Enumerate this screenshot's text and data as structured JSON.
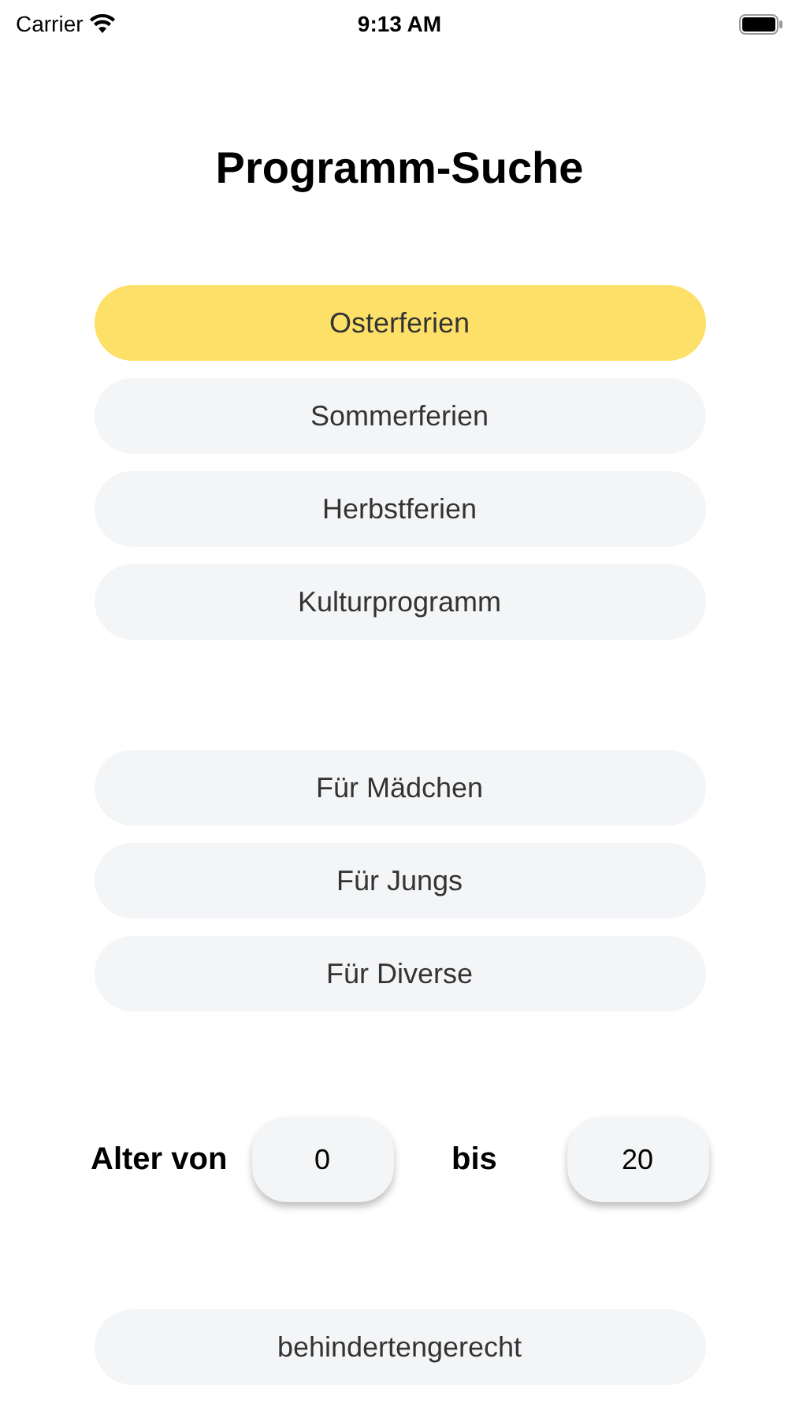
{
  "status_bar": {
    "carrier": "Carrier",
    "time": "9:13 AM"
  },
  "title": "Programm-Suche",
  "program_types": [
    {
      "label": "Osterferien",
      "selected": true
    },
    {
      "label": "Sommerferien",
      "selected": false
    },
    {
      "label": "Herbstferien",
      "selected": false
    },
    {
      "label": "Kulturprogramm",
      "selected": false
    }
  ],
  "gender_options": [
    {
      "label": "Für Mädchen",
      "selected": false
    },
    {
      "label": "Für Jungs",
      "selected": false
    },
    {
      "label": "Für Diverse",
      "selected": false
    }
  ],
  "age": {
    "label": "Alter von",
    "from_value": "0",
    "to_label": "bis",
    "to_value": "20"
  },
  "accessibility": {
    "label": "behindertengerecht",
    "selected": false
  }
}
